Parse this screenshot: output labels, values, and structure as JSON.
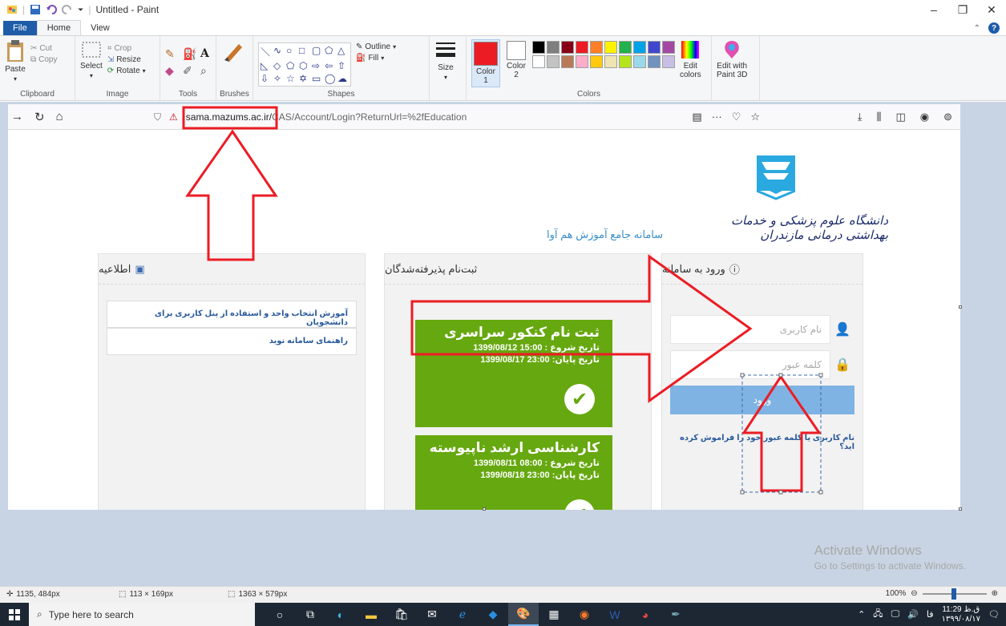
{
  "window": {
    "title": "Untitled - Paint",
    "controls": {
      "minimize": "–",
      "restore": "❐",
      "close": "✕"
    }
  },
  "ribbon_tabs": [
    "File",
    "Home",
    "View"
  ],
  "ribbon": {
    "clipboard": {
      "paste": "Paste",
      "cut": "Cut",
      "copy": "Copy",
      "label": "Clipboard"
    },
    "image": {
      "select": "Select",
      "crop": "Crop",
      "resize": "Resize",
      "rotate": "Rotate",
      "label": "Image"
    },
    "tools": {
      "label": "Tools"
    },
    "brushes": {
      "label": "Brushes"
    },
    "shapes": {
      "outline": "Outline",
      "fill": "Fill",
      "label": "Shapes"
    },
    "size": {
      "label": "Size"
    },
    "colors": {
      "color1": "Color\n1",
      "color2": "Color\n2",
      "edit": "Edit\ncolors",
      "label": "Colors",
      "color1_value": "#ec1c24",
      "palette_row1": [
        "#000000",
        "#7f7f7f",
        "#880015",
        "#ed1c24",
        "#ff7f27",
        "#fff200",
        "#22b14c",
        "#00a2e8",
        "#3f48cc",
        "#a349a4"
      ],
      "palette_row2": [
        "#ffffff",
        "#c3c3c3",
        "#b97a57",
        "#ffaec9",
        "#ffc90e",
        "#efe4b0",
        "#b5e61d",
        "#99d9ea",
        "#7092be",
        "#c8bfe7"
      ]
    },
    "paint3d": {
      "label": "Edit with\nPaint 3D"
    }
  },
  "browser": {
    "url_host": "sama.mazums.ac.ir/",
    "url_path": "CAS/Account/Login?ReturnUrl=%2fEducation"
  },
  "site": {
    "university": "دانشگاه علوم پزشکی و خدمات بهداشتی درمانی مازندران",
    "system_name": "سامانه جامع آموزش هم آوا",
    "news_panel": {
      "title": "اطلاعیه",
      "items": [
        "آموزش انتخاب واحد و استفاده از پنل کاربری برای دانشجویان",
        "راهنمای سامانه نوید"
      ]
    },
    "admission_panel": {
      "title": "ثبت‌نام پذیرفته‌شدگان",
      "cards": [
        {
          "title": "ثبت نام کنکور سراسری",
          "start": "تاریخ شروع : 15:00 1399/08/12",
          "end": "تاریخ پایان: 23:00 1399/08/17"
        },
        {
          "title": "کارشناسی ارشد ناپیوسته",
          "start": "تاریخ شروع : 08:00 1399/08/11",
          "end": "تاریخ پایان: 23:00 1399/08/18"
        }
      ]
    },
    "login_panel": {
      "title": "ورود به سامانه",
      "username_placeholder": "نام کاربری",
      "password_placeholder": "کلمه عبور",
      "login_button": "ورود",
      "forgot": "نام کاربری یا کلمه عبور خود را فراموش کرده اید؟"
    }
  },
  "watermark": {
    "line1": "Activate Windows",
    "line2": "Go to Settings to activate Windows."
  },
  "status": {
    "cursor_pos": "1135, 484px",
    "selection_size": "113 × 169px",
    "canvas_size": "1363 × 579px",
    "zoom": "100%"
  },
  "taskbar": {
    "search_placeholder": "Type here to search",
    "time": "11:29 ق.ظ",
    "date": "۱۳۹۹/۰۸/۱۷",
    "lang": "فا"
  }
}
